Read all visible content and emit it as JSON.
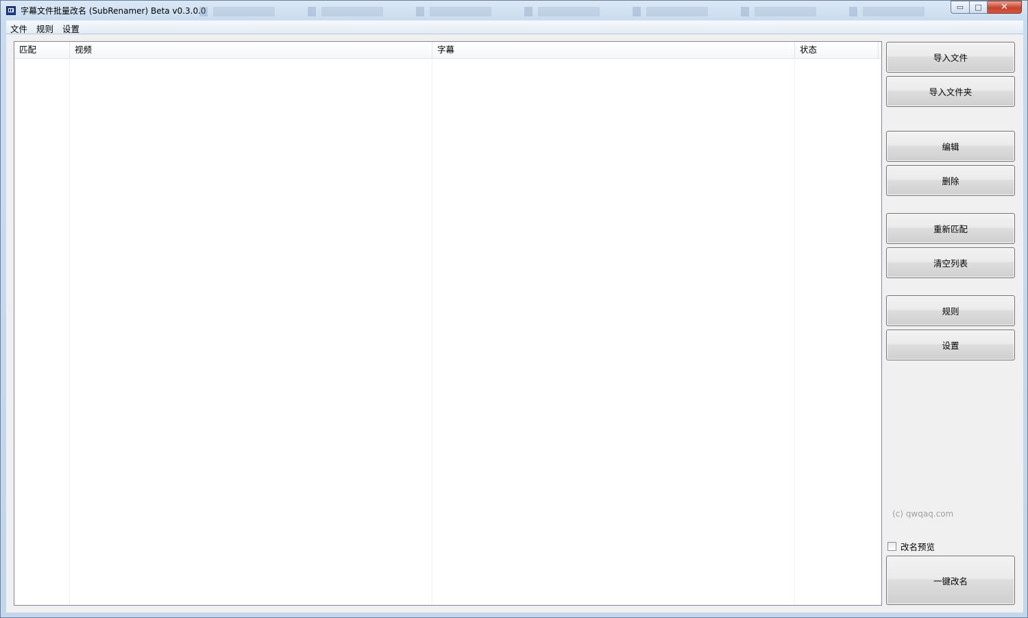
{
  "window": {
    "title": "字幕文件批量改名 (SubRenamer) Beta v0.3.0.0",
    "controls": {
      "minimize": "▭",
      "maximize": "□",
      "close": "✕"
    }
  },
  "menu": [
    "文件",
    "规则",
    "设置"
  ],
  "list": {
    "columns": [
      "匹配",
      "视频",
      "字幕",
      "状态"
    ],
    "rows": []
  },
  "buttons": {
    "import_file": "导入文件",
    "import_folder": "导入文件夹",
    "edit": "编辑",
    "delete": "删除",
    "rematch": "重新匹配",
    "clear_list": "清空列表",
    "rules": "规则",
    "settings": "设置",
    "rename_all": "一键改名"
  },
  "copyright": "(c) qwqaq.com",
  "rename_preview": {
    "label": "改名预览",
    "checked": false
  }
}
